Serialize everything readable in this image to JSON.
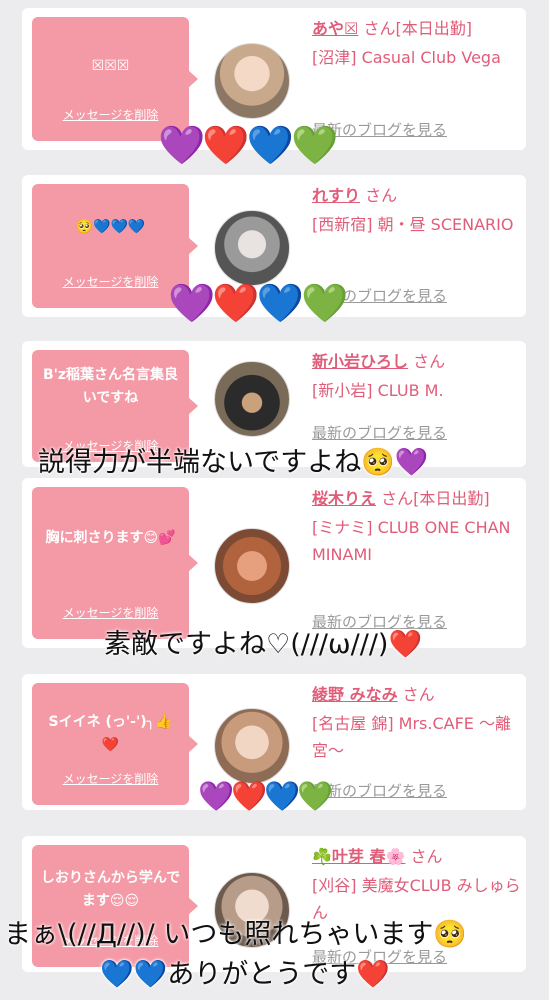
{
  "cards": [
    {
      "message": "☒☒☒",
      "delete_label": "メッセージを削除",
      "name": "あや☒",
      "name_suffix": " さん[本日出勤]",
      "shop": "[沼津] Casual Club Vega",
      "blog_label": "最新のブログを見る",
      "hearts": "💜❤️💙💚"
    },
    {
      "message": "🥺💙💙💙",
      "delete_label": "メッセージを削除",
      "name": "れすり",
      "name_suffix": " さん",
      "shop": "[西新宿] 朝・昼 SCENARIO",
      "blog_label": "最新のブログを見る",
      "hearts": "💜❤️💙💚"
    },
    {
      "message": "B'z稲葉さん名言集良いですね",
      "delete_label": "メッセージを削除",
      "name": "新小岩ひろし",
      "name_suffix": " さん",
      "shop": "[新小岩] CLUB M.",
      "blog_label": "最新のブログを見る"
    },
    {
      "message": "胸に刺さります😊💕",
      "delete_label": "メッセージを削除",
      "name": "桜木りえ",
      "name_suffix": " さん[本日出勤]",
      "shop": "[ミナミ] CLUB ONE CHAN MINAMI",
      "blog_label": "最新のブログを見る"
    },
    {
      "message": "Sイイネ (っ'-')╮👍❤️",
      "delete_label": "メッセージを削除",
      "name": "綾野 みなみ",
      "name_suffix": " さん",
      "shop": "[名古屋 錦] Mrs.CAFE ～離宮～",
      "blog_label": "最新のブログを見る",
      "hearts": "💜❤️💙💚"
    },
    {
      "message": "しおりさんから学んでます😌😌",
      "delete_label": "メッセージを削除",
      "name": "☘️叶芽 春🌸",
      "name_suffix": " さん",
      "shop": "[刈谷] 美魔女CLUB みしゅらん",
      "blog_label": "最新のブログを見る"
    }
  ],
  "overlays": {
    "line1": "説得力が半端ないですよね🥺💜",
    "line2": "素敵ですよね♡(///ω///)❤️",
    "line3": "まぁ\\(//Д//)/ いつも照れちゃいます🥺",
    "line4": "💙💙ありがとうです❤️"
  },
  "colors": {
    "bubble": "#f49aa6",
    "name": "#e05d79",
    "background": "#ececef"
  }
}
